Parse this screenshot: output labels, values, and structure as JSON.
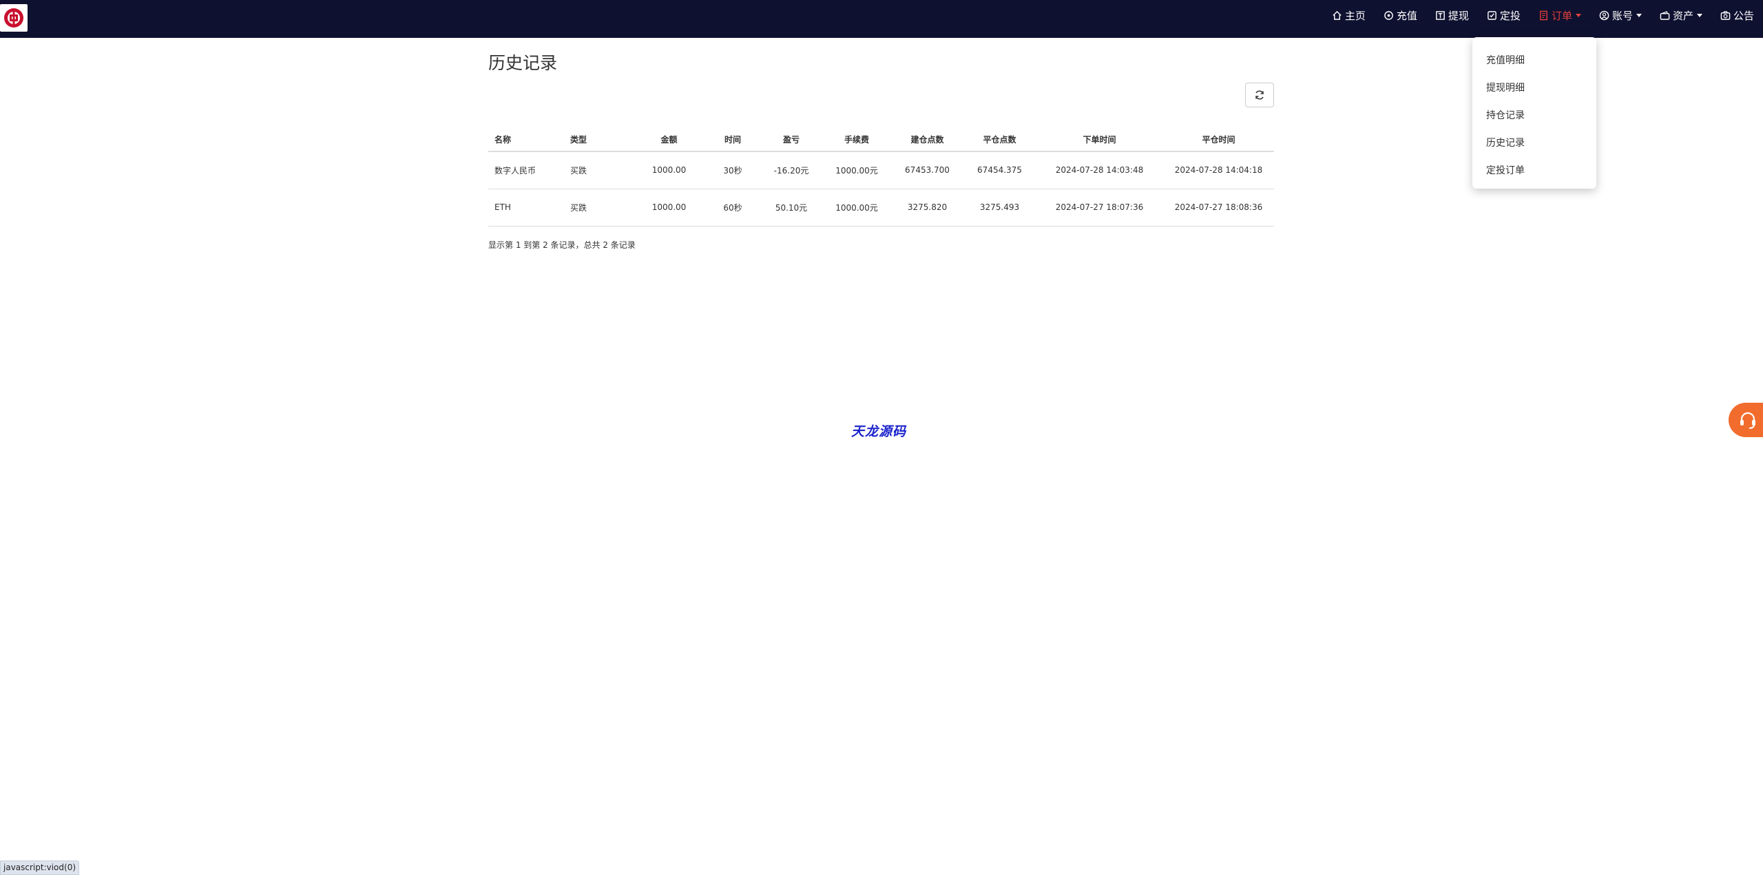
{
  "nav": {
    "items": [
      {
        "label": "主页",
        "icon": "home-icon"
      },
      {
        "label": "充值",
        "icon": "recharge-icon"
      },
      {
        "label": "提现",
        "icon": "withdraw-icon"
      },
      {
        "label": "定投",
        "icon": "check-square-icon"
      },
      {
        "label": "订单",
        "icon": "order-icon"
      },
      {
        "label": "账号",
        "icon": "user-icon"
      },
      {
        "label": "资产",
        "icon": "wallet-icon"
      },
      {
        "label": "公告",
        "icon": "notice-icon"
      }
    ]
  },
  "dropdown": {
    "items": [
      "充值明细",
      "提现明细",
      "持仓记录",
      "历史记录",
      "定投订单"
    ]
  },
  "page": {
    "title": "历史记录",
    "pagination_info": "显示第 1 到第 2 条记录，总共 2 条记录",
    "watermark": "天龙源码"
  },
  "table": {
    "headers": [
      "名称",
      "类型",
      "金额",
      "时间",
      "盈亏",
      "手续费",
      "建仓点数",
      "平仓点数",
      "下单时间",
      "平仓时间"
    ],
    "rows": [
      [
        "数字人民币",
        "买跌",
        "1000.00",
        "30秒",
        "-16.20元",
        "1000.00元",
        "67453.700",
        "67454.375",
        "2024-07-28 14:03:48",
        "2024-07-28 14:04:18"
      ],
      [
        "ETH",
        "买跌",
        "1000.00",
        "60秒",
        "50.10元",
        "1000.00元",
        "3275.820",
        "3275.493",
        "2024-07-27 18:07:36",
        "2024-07-27 18:08:36"
      ]
    ]
  },
  "status_bar": {
    "text": "javascript:viod(0)"
  },
  "colors": {
    "navbar": "#0f1130",
    "active": "#e0403a",
    "support": "#f26c2d",
    "watermark": "#1a22cc"
  }
}
